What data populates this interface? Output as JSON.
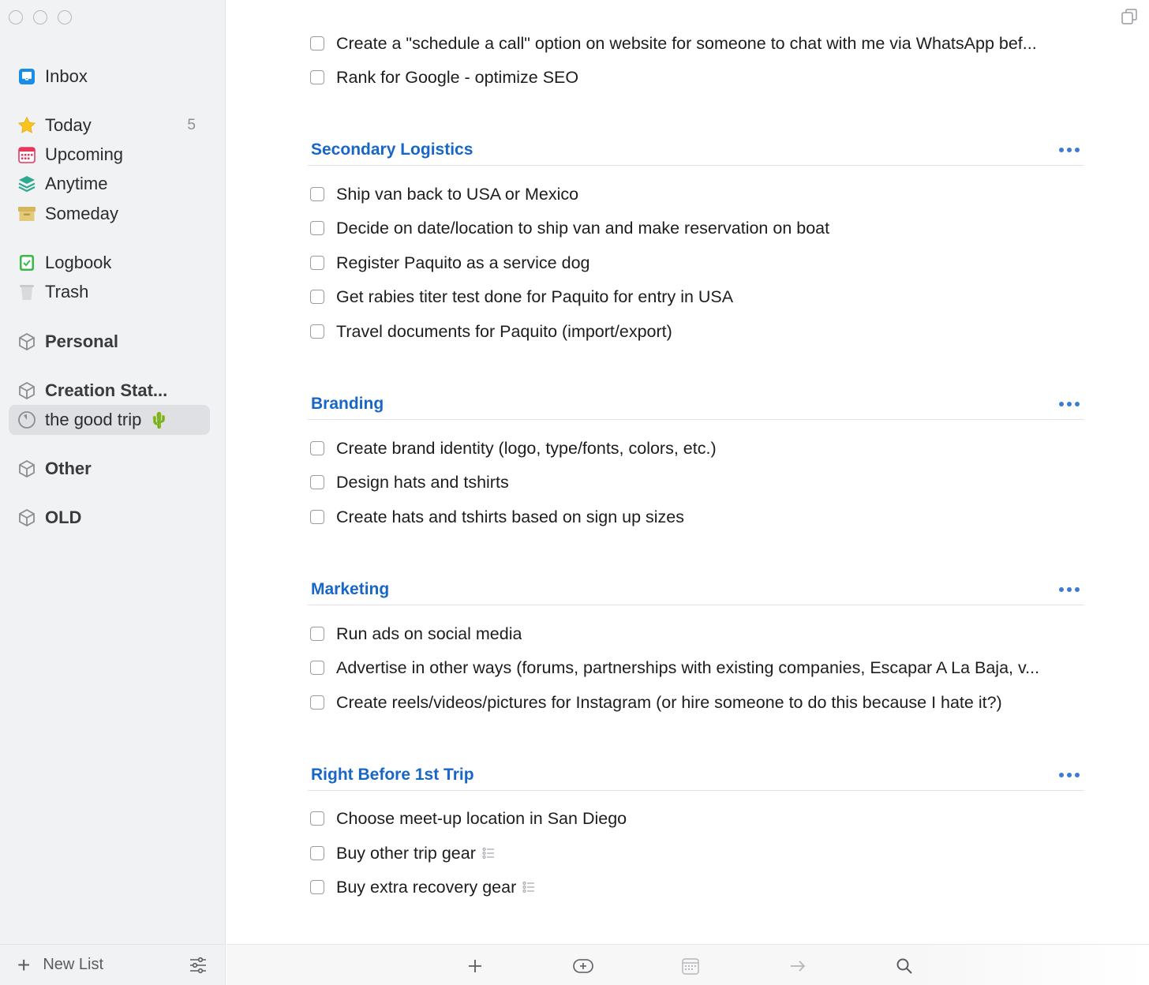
{
  "window": {
    "controls": [
      "close",
      "minimize",
      "zoom"
    ]
  },
  "sidebar": {
    "items": [
      {
        "label": "Inbox",
        "icon": "inbox-icon"
      },
      {
        "label": "Today",
        "icon": "star-icon",
        "count": "5"
      },
      {
        "label": "Upcoming",
        "icon": "calendar-icon"
      },
      {
        "label": "Anytime",
        "icon": "stack-icon"
      },
      {
        "label": "Someday",
        "icon": "archive-box-icon"
      },
      {
        "label": "Logbook",
        "icon": "logbook-icon"
      },
      {
        "label": "Trash",
        "icon": "trash-icon"
      }
    ],
    "areas": [
      {
        "label": "Personal",
        "icon": "area-cube-icon"
      },
      {
        "label": "Creation Stat...",
        "icon": "area-cube-icon"
      },
      {
        "label": "Other",
        "icon": "area-cube-icon"
      },
      {
        "label": "OLD",
        "icon": "area-cube-icon"
      }
    ],
    "project": {
      "label": "the good trip",
      "emoji": "🌵",
      "icon": "progress-circle-icon",
      "selected": true
    },
    "footer": {
      "new_list_label": "New List"
    }
  },
  "main": {
    "top_tasks": [
      "Create a \"schedule a call\" option on website for someone to chat with me via WhatsApp bef...",
      "Rank for Google - optimize SEO"
    ],
    "sections": [
      {
        "title": "Secondary Logistics",
        "tasks": [
          {
            "text": "Ship van back to USA or Mexico"
          },
          {
            "text": "Decide on date/location to ship van and make reservation on boat"
          },
          {
            "text": "Register Paquito as a service dog"
          },
          {
            "text": "Get rabies titer test done for Paquito for entry in USA"
          },
          {
            "text": "Travel documents for Paquito (import/export)"
          }
        ]
      },
      {
        "title": "Branding",
        "tasks": [
          {
            "text": "Create brand identity (logo, type/fonts, colors, etc.)"
          },
          {
            "text": "Design hats and tshirts"
          },
          {
            "text": "Create hats and tshirts based on sign up sizes"
          }
        ]
      },
      {
        "title": "Marketing",
        "tasks": [
          {
            "text": "Run ads on social media"
          },
          {
            "text": "Advertise in other ways (forums, partnerships with existing companies, Escapar A La Baja, v..."
          },
          {
            "text": "Create reels/videos/pictures for Instagram (or hire someone to do this because I hate it?)"
          }
        ]
      },
      {
        "title": "Right Before 1st Trip",
        "tasks": [
          {
            "text": "Choose meet-up location in San Diego"
          },
          {
            "text": "Buy other trip gear",
            "has_checklist": true
          },
          {
            "text": "Buy extra recovery gear",
            "has_checklist": true
          }
        ]
      }
    ]
  },
  "toolbar": {
    "buttons": [
      "add-todo-icon",
      "add-heading-icon",
      "when-calendar-icon",
      "move-arrow-icon",
      "search-icon"
    ]
  },
  "colors": {
    "heading": "#1966c9",
    "sidebar_bg": "#f1f2f4",
    "selected_bg": "#dfe0e4"
  }
}
